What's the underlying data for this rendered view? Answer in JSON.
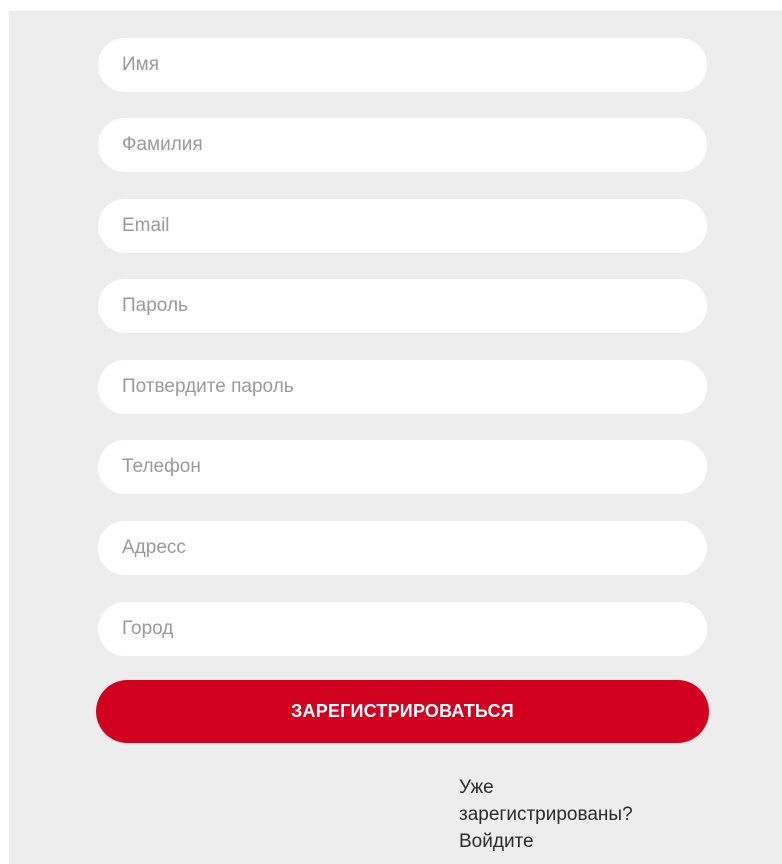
{
  "form": {
    "fields": [
      {
        "placeholder": "Имя",
        "value": ""
      },
      {
        "placeholder": "Фамилия",
        "value": ""
      },
      {
        "placeholder": "Email",
        "value": ""
      },
      {
        "placeholder": "Пароль",
        "value": ""
      },
      {
        "placeholder": "Потвердите пароль",
        "value": ""
      },
      {
        "placeholder": "Телефон",
        "value": ""
      },
      {
        "placeholder": "Адресс",
        "value": ""
      },
      {
        "placeholder": "Город",
        "value": ""
      }
    ],
    "submit_label": "ЗАРЕГИСТРИРОВАТЬСЯ",
    "login_link": "Уже\nзарегистрированы?\nВойдите"
  },
  "colors": {
    "panel_background": "#ededed",
    "field_background": "#ffffff",
    "button_background": "#d2001f",
    "button_text": "#ffffff",
    "placeholder_text": "#9a9a9a"
  }
}
